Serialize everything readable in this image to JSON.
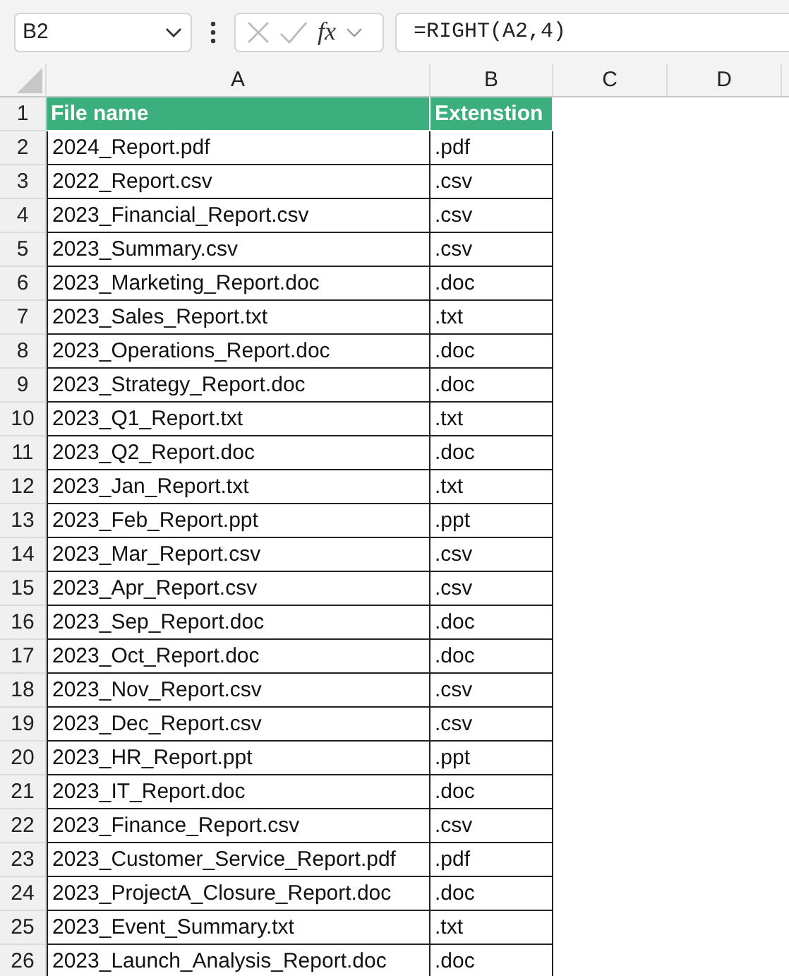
{
  "name_box": {
    "value": "B2"
  },
  "formula_bar": {
    "value": "=RIGHT(A2,4)",
    "fx": "fx"
  },
  "columns": [
    "A",
    "B",
    "C",
    "D"
  ],
  "header_row": {
    "number": "1",
    "cells": [
      "File name",
      "Extenstion"
    ]
  },
  "rows": [
    {
      "number": "2",
      "cells": [
        "2024_Report.pdf",
        ".pdf"
      ]
    },
    {
      "number": "3",
      "cells": [
        "2022_Report.csv",
        ".csv"
      ]
    },
    {
      "number": "4",
      "cells": [
        "2023_Financial_Report.csv",
        ".csv"
      ]
    },
    {
      "number": "5",
      "cells": [
        "2023_Summary.csv",
        ".csv"
      ]
    },
    {
      "number": "6",
      "cells": [
        "2023_Marketing_Report.doc",
        ".doc"
      ]
    },
    {
      "number": "7",
      "cells": [
        "2023_Sales_Report.txt",
        ".txt"
      ]
    },
    {
      "number": "8",
      "cells": [
        "2023_Operations_Report.doc",
        ".doc"
      ]
    },
    {
      "number": "9",
      "cells": [
        "2023_Strategy_Report.doc",
        ".doc"
      ]
    },
    {
      "number": "10",
      "cells": [
        "2023_Q1_Report.txt",
        ".txt"
      ]
    },
    {
      "number": "11",
      "cells": [
        "2023_Q2_Report.doc",
        ".doc"
      ]
    },
    {
      "number": "12",
      "cells": [
        "2023_Jan_Report.txt",
        ".txt"
      ]
    },
    {
      "number": "13",
      "cells": [
        "2023_Feb_Report.ppt",
        ".ppt"
      ]
    },
    {
      "number": "14",
      "cells": [
        "2023_Mar_Report.csv",
        ".csv"
      ]
    },
    {
      "number": "15",
      "cells": [
        "2023_Apr_Report.csv",
        ".csv"
      ]
    },
    {
      "number": "16",
      "cells": [
        "2023_Sep_Report.doc",
        ".doc"
      ]
    },
    {
      "number": "17",
      "cells": [
        "2023_Oct_Report.doc",
        ".doc"
      ]
    },
    {
      "number": "18",
      "cells": [
        "2023_Nov_Report.csv",
        ".csv"
      ]
    },
    {
      "number": "19",
      "cells": [
        "2023_Dec_Report.csv",
        ".csv"
      ]
    },
    {
      "number": "20",
      "cells": [
        "2023_HR_Report.ppt",
        ".ppt"
      ]
    },
    {
      "number": "21",
      "cells": [
        "2023_IT_Report.doc",
        ".doc"
      ]
    },
    {
      "number": "22",
      "cells": [
        "2023_Finance_Report.csv",
        ".csv"
      ]
    },
    {
      "number": "23",
      "cells": [
        "2023_Customer_Service_Report.pdf",
        ".pdf"
      ]
    },
    {
      "number": "24",
      "cells": [
        "2023_ProjectA_Closure_Report.doc",
        ".doc"
      ]
    },
    {
      "number": "25",
      "cells": [
        "2023_Event_Summary.txt",
        ".txt"
      ]
    },
    {
      "number": "26",
      "cells": [
        "2023_Launch_Analysis_Report.doc",
        ".doc"
      ]
    }
  ]
}
